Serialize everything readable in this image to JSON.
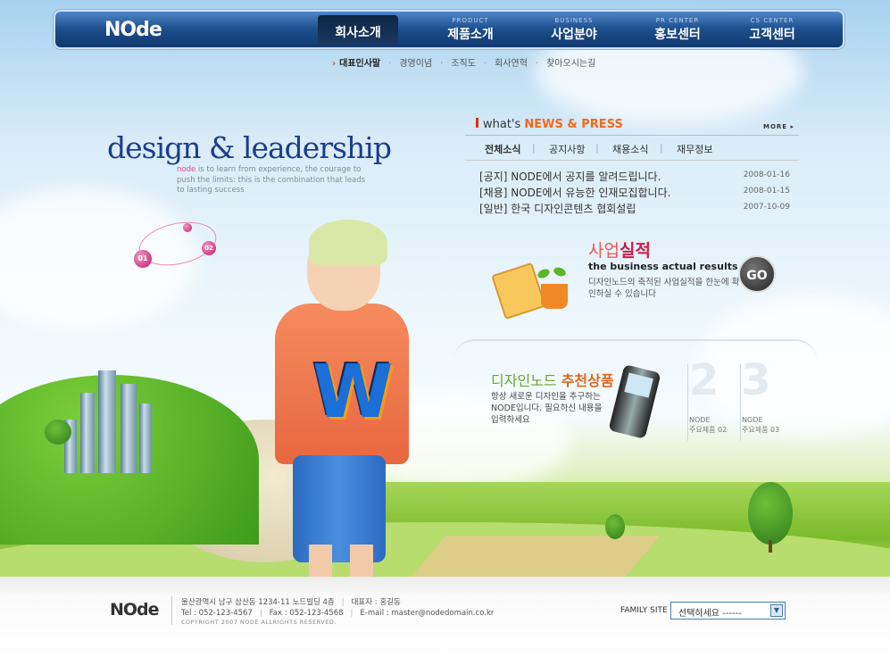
{
  "brand": {
    "logo": "NOde"
  },
  "nav": {
    "items": [
      {
        "sub": "",
        "label": "회사소개",
        "active": true
      },
      {
        "sub": "PRODUCT",
        "label": "제품소개"
      },
      {
        "sub": "BUSINESS",
        "label": "사업분야"
      },
      {
        "sub": "PR CENTER",
        "label": "홍보센터"
      },
      {
        "sub": "CS CENTER",
        "label": "고객센터"
      }
    ]
  },
  "subnav": {
    "items": [
      "대표인사말",
      "경영이념",
      "조직도",
      "회사연혁",
      "찾아오시는길"
    ]
  },
  "hero": {
    "headline_1": "design",
    "headline_amp": "&",
    "headline_2": "leadership",
    "tagline_brand": "node",
    "tagline": " is to learn from experience, the courage to push the limits: this is the combination that leads to lasting success",
    "bubble_1": "01",
    "bubble_2": "02"
  },
  "news": {
    "title_prefix": "what's ",
    "title_highlight": "NEWS & PRESS",
    "more": "MORE ▸",
    "tabs": [
      "전체소식",
      "공지사항",
      "채용소식",
      "재무정보"
    ],
    "items": [
      {
        "text": "[공지] NODE에서 공지를 알려드립니다.",
        "date": "2008-01-16"
      },
      {
        "text": "[채용] NODE에서 유능한 인재모집합니다.",
        "date": "2008-01-15"
      },
      {
        "text": "[일반] 한국 디자인콘텐츠 협회설립",
        "date": "2007-10-09"
      }
    ]
  },
  "business": {
    "title_light": "사업",
    "title_bold": "실적",
    "subtitle": "the business actual results",
    "desc": "디자인노드의 축적된 사업실적을 한눈에 확인하실 수 있습니다",
    "go": "GO"
  },
  "recommend": {
    "title_light": "디자인노드",
    "title_bold": "추천상품",
    "desc": "항상 새로운 디자인을 추구하는 NODE입니다. 필요하신 내용을 입력하세요",
    "products": [
      {
        "num": "2",
        "name": "NODE",
        "label": "주요제품 02"
      },
      {
        "num": "3",
        "name": "NODE",
        "label": "주요제품 03"
      }
    ]
  },
  "footer": {
    "logo": "NOde",
    "address": "울산광역시 남구 삼산동 1234-11 노드빌딩 4층",
    "ceo": "대표자 : 홍길동",
    "tel": "Tel : 052-123-4567",
    "fax": "Fax : 052-123-4568",
    "email": "E-mail : master@nodedomain.co.kr",
    "copyright": "COPYRIGHT 2007 NODE ALLRIGHTS RESERVED.",
    "family_label": "FAMILY SITE",
    "family_value": "선택하세요 ------"
  },
  "colors": {
    "nav": "#1c4d8c",
    "accent": "#f26a1a",
    "headline": "#1a3d8f"
  }
}
